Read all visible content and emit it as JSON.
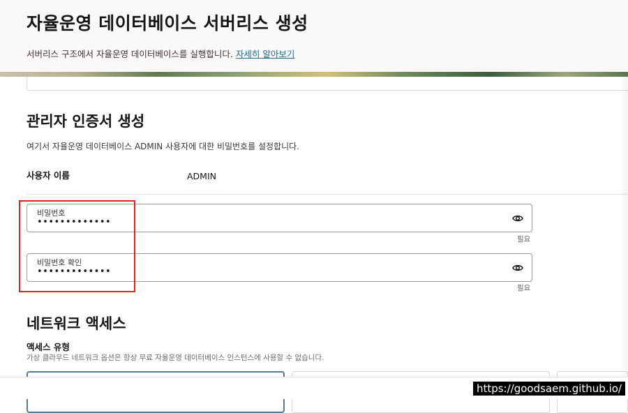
{
  "header": {
    "title": "자율운영 데이터베이스 서버리스 생성",
    "description": "서버리스 구조에서 자율운영 데이터베이스를 실행합니다.",
    "link": "자세히 알아보기"
  },
  "admin_credentials": {
    "title": "관리자 인증서 생성",
    "description": "여기서 자율운영 데이터베이스 ADMIN 사용자에 대한 비밀번호를 설정합니다.",
    "username_label": "사용자 이름",
    "username_value": "ADMIN",
    "password": {
      "label": "비밀번호",
      "value": "•••••••••••••",
      "required": "필요"
    },
    "confirm_password": {
      "label": "비밀번호 확인",
      "value": "•••••••••••••",
      "required": "필요"
    }
  },
  "network_access": {
    "title": "네트워크 액세스",
    "access_type_label": "액세스 유형",
    "access_type_desc": "가상 클라우드 네트워크 옵션은 항상 무료 자율운영 데이터베이스 인스턴스에 사용할 수 없습니다."
  },
  "watermark": "https://goodsaem.github.io/",
  "icons": {
    "show_password": "eye-icon"
  },
  "colors": {
    "link": "#1f6e8c",
    "highlight": "#e0201f",
    "selected_card": "#4f7d9a"
  }
}
